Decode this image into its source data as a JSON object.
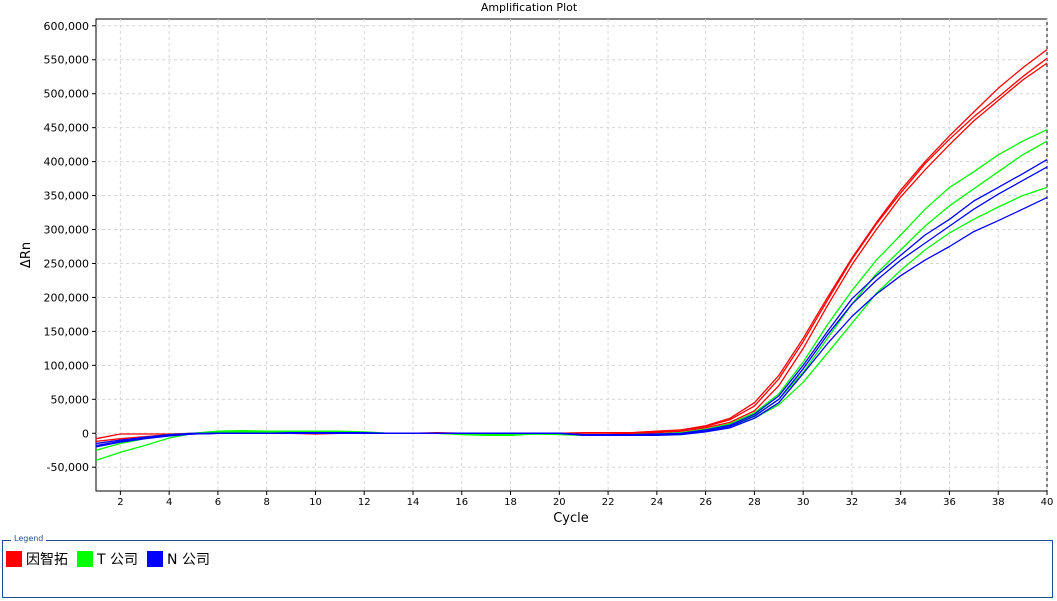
{
  "chart_data": {
    "type": "line",
    "title": "Amplification Plot",
    "xlabel": "Cycle",
    "ylabel": "ΔRn",
    "xlim": [
      1,
      40
    ],
    "ylim": [
      -85000,
      610000
    ],
    "x_ticks": [
      2,
      4,
      6,
      8,
      10,
      12,
      14,
      16,
      18,
      20,
      22,
      24,
      26,
      28,
      30,
      32,
      34,
      36,
      38,
      40
    ],
    "y_ticks": [
      -50000,
      0,
      50000,
      100000,
      150000,
      200000,
      250000,
      300000,
      350000,
      400000,
      450000,
      500000,
      550000,
      600000
    ],
    "y_tick_labels": [
      "-50,000",
      "0",
      "50,000",
      "100,000",
      "150,000",
      "200,000",
      "250,000",
      "300,000",
      "350,000",
      "400,000",
      "450,000",
      "500,000",
      "550,000",
      "600,000"
    ],
    "grid": true,
    "x": [
      1,
      2,
      3,
      4,
      5,
      6,
      7,
      8,
      9,
      10,
      11,
      12,
      13,
      14,
      15,
      16,
      17,
      18,
      19,
      20,
      21,
      22,
      23,
      24,
      25,
      26,
      27,
      28,
      29,
      30,
      31,
      32,
      33,
      34,
      35,
      36,
      37,
      38,
      39,
      40
    ],
    "series": [
      {
        "group": "因智拓",
        "color": "#ff0000",
        "values": [
          -8000,
          -1000,
          -1000,
          -1000,
          0,
          0,
          0,
          0,
          0,
          -1000,
          0,
          0,
          0,
          0,
          1000,
          0,
          -1000,
          -1000,
          0,
          -1000,
          -3000,
          -2000,
          -1000,
          1000,
          3000,
          8000,
          16000,
          33000,
          70000,
          125000,
          188000,
          248000,
          300000,
          348000,
          388000,
          425000,
          460000,
          490000,
          520000,
          545000
        ]
      },
      {
        "group": "因智拓",
        "color": "#ff0000",
        "values": [
          -12000,
          -8000,
          -5000,
          -2000,
          0,
          0,
          0,
          0,
          0,
          0,
          1000,
          0,
          0,
          0,
          0,
          0,
          0,
          0,
          0,
          0,
          1000,
          1000,
          1000,
          3000,
          5000,
          10000,
          20000,
          40000,
          80000,
          135000,
          196000,
          256000,
          308000,
          354000,
          397000,
          433000,
          466000,
          495000,
          525000,
          552000
        ]
      },
      {
        "group": "因智拓",
        "color": "#ff0000",
        "values": [
          -15000,
          -10000,
          -6000,
          -3000,
          -1000,
          0,
          0,
          0,
          0,
          0,
          0,
          0,
          0,
          0,
          0,
          0,
          0,
          0,
          0,
          0,
          -1000,
          -1000,
          0,
          2000,
          5000,
          11000,
          22000,
          45000,
          85000,
          140000,
          200000,
          258000,
          310000,
          358000,
          400000,
          438000,
          473000,
          508000,
          538000,
          565000
        ]
      },
      {
        "group": "T 公司",
        "color": "#00ff00",
        "values": [
          -40000,
          -28000,
          -18000,
          -7000,
          0,
          3000,
          4000,
          3000,
          3000,
          3000,
          3000,
          2000,
          0,
          0,
          0,
          -2000,
          -3000,
          -3000,
          -1000,
          -2000,
          -3000,
          -3000,
          -3000,
          -2000,
          0,
          5000,
          10000,
          22000,
          42000,
          75000,
          118000,
          162000,
          206000,
          240000,
          270000,
          295000,
          315000,
          333000,
          350000,
          362000
        ]
      },
      {
        "group": "T 公司",
        "color": "#00ff00",
        "values": [
          -25000,
          -15000,
          -8000,
          -3000,
          0,
          2000,
          3000,
          2000,
          2000,
          2000,
          2000,
          1000,
          0,
          0,
          0,
          -1000,
          -2000,
          -2000,
          -1000,
          -1000,
          -2000,
          -2000,
          -2000,
          -1000,
          1000,
          5000,
          12000,
          26000,
          50000,
          90000,
          140000,
          190000,
          235000,
          270000,
          305000,
          335000,
          360000,
          385000,
          410000,
          430000
        ]
      },
      {
        "group": "T 公司",
        "color": "#00ff00",
        "values": [
          -20000,
          -12000,
          -6000,
          -2000,
          0,
          2000,
          2000,
          2000,
          2000,
          2000,
          2000,
          1000,
          0,
          0,
          0,
          -1000,
          -2000,
          -2000,
          -1000,
          -1000,
          -2000,
          -2000,
          -2000,
          -1000,
          1000,
          6000,
          14000,
          30000,
          58000,
          105000,
          160000,
          210000,
          255000,
          292000,
          330000,
          362000,
          385000,
          410000,
          430000,
          447000
        ]
      },
      {
        "group": "N 公司",
        "color": "#0000ff",
        "values": [
          -18000,
          -12000,
          -7000,
          -3000,
          -1000,
          0,
          0,
          0,
          0,
          0,
          0,
          0,
          0,
          0,
          0,
          0,
          0,
          0,
          0,
          0,
          -2000,
          -2000,
          -2000,
          -2000,
          -1000,
          3000,
          10000,
          25000,
          50000,
          95000,
          145000,
          190000,
          225000,
          255000,
          280000,
          305000,
          330000,
          352000,
          372000,
          392000
        ]
      },
      {
        "group": "N 公司",
        "color": "#0000ff",
        "values": [
          -15000,
          -10000,
          -6000,
          -2000,
          0,
          0,
          0,
          0,
          1000,
          1000,
          1000,
          1000,
          0,
          0,
          0,
          0,
          0,
          0,
          0,
          0,
          -2000,
          -2000,
          -2000,
          -1000,
          0,
          5000,
          12000,
          28000,
          55000,
          100000,
          150000,
          198000,
          232000,
          262000,
          292000,
          315000,
          342000,
          362000,
          382000,
          403000
        ]
      },
      {
        "group": "N 公司",
        "color": "#0000ff",
        "values": [
          -20000,
          -13000,
          -8000,
          -4000,
          -1000,
          0,
          0,
          0,
          0,
          0,
          0,
          0,
          0,
          0,
          0,
          0,
          0,
          0,
          0,
          0,
          -3000,
          -3000,
          -3000,
          -3000,
          -2000,
          2000,
          8000,
          22000,
          45000,
          88000,
          132000,
          172000,
          205000,
          232000,
          255000,
          275000,
          297000,
          313000,
          330000,
          347000
        ]
      }
    ]
  },
  "legend": {
    "caption": "Legend",
    "items": [
      {
        "label": "因智拓",
        "color": "#ff0000"
      },
      {
        "label": "T 公司",
        "color": "#00ff00"
      },
      {
        "label": "N 公司",
        "color": "#0000ff"
      }
    ]
  }
}
